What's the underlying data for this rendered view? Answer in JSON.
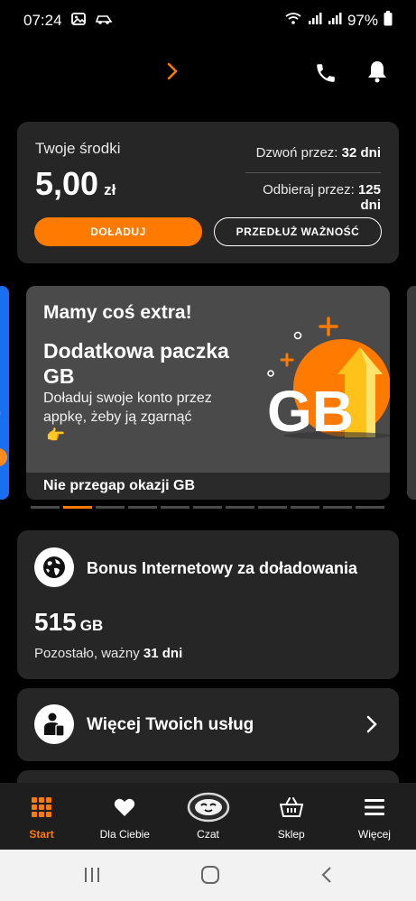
{
  "status_bar": {
    "time": "07:24",
    "battery": "97%"
  },
  "balance": {
    "title": "Twoje środki",
    "amount": "5,00",
    "currency": "zł",
    "call_label": "Dzwoń przez:",
    "call_value": "32 dni",
    "receive_label": "Odbieraj przez:",
    "receive_value": "125 dni",
    "topup_button": "DOŁADUJ",
    "extend_button": "PRZEDŁUŻ WAŻNOŚĆ"
  },
  "promo": {
    "kicker": "Mamy coś extra!",
    "title": "Dodatkowa paczka GB",
    "description": "Doładuj swoje konto przez appkę, żeby ją zgarnąć",
    "emoji": "👉",
    "art_text": "GB",
    "footer": "Nie przegap okazji GB",
    "pages_total": 11,
    "active_page": 2
  },
  "bonus": {
    "title": "Bonus Internetowy za doładowania",
    "amount": "515",
    "unit": "GB",
    "remaining_label": "Pozostało, ważny",
    "remaining_value": "31 dni"
  },
  "services": {
    "title": "Więcej Twoich usług"
  },
  "bottom_nav": {
    "items": [
      {
        "label": "Start",
        "icon": "grid-icon",
        "active": true
      },
      {
        "label": "Dla Ciebie",
        "icon": "heart-icon",
        "active": false
      },
      {
        "label": "Czat",
        "icon": "chatbot-icon",
        "active": false
      },
      {
        "label": "Sklep",
        "icon": "basket-icon",
        "active": false
      },
      {
        "label": "Więcej",
        "icon": "menu-icon",
        "active": false
      }
    ]
  },
  "colors": {
    "accent": "#ff7a00",
    "card": "#262626",
    "background": "#000000"
  }
}
